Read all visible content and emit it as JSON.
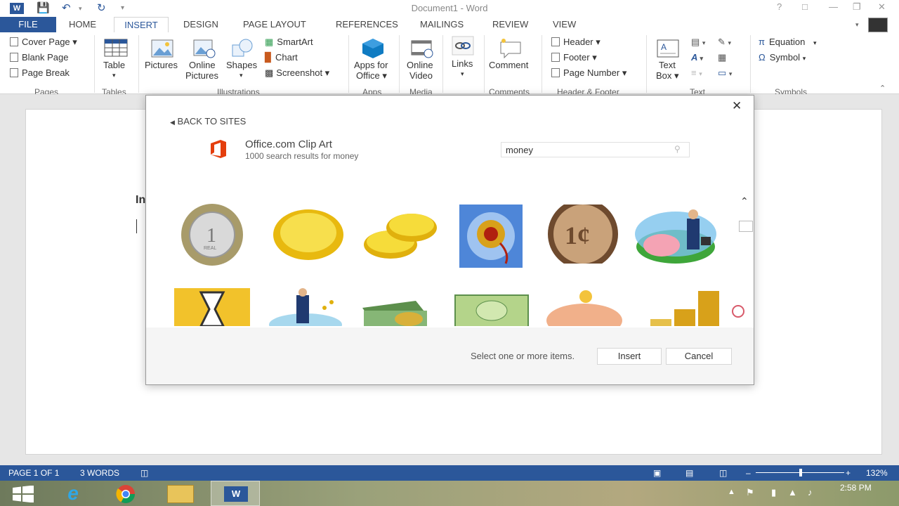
{
  "titlebar": {
    "title": "Document1 - Word",
    "help": "?"
  },
  "tabs": [
    "FILE",
    "HOME",
    "INSERT",
    "DESIGN",
    "PAGE LAYOUT",
    "REFERENCES",
    "MAILINGS",
    "REVIEW",
    "VIEW"
  ],
  "ribbon": {
    "pages": {
      "cover": "Cover Page",
      "blank": "Blank Page",
      "break": "Page Break",
      "group": "Pages"
    },
    "tables": {
      "table": "Table",
      "group": "Tables"
    },
    "illustrations": {
      "pictures": "Pictures",
      "online1": "Online",
      "online2": "Pictures",
      "shapes": "Shapes",
      "smartart": "SmartArt",
      "chart": "Chart",
      "screenshot": "Screenshot",
      "group": "Illustrations"
    },
    "apps": {
      "l1": "Apps for",
      "l2": "Office",
      "group": "Apps"
    },
    "media": {
      "l1": "Online",
      "l2": "Video",
      "group": "Media"
    },
    "links": {
      "label": "Links"
    },
    "comments": {
      "comment": "Comment",
      "group": "Comments"
    },
    "hf": {
      "header": "Header",
      "footer": "Footer",
      "pagenum": "Page Number",
      "group": "Header & Footer"
    },
    "text": {
      "l1": "Text",
      "l2": "Box",
      "group": "Text"
    },
    "symbols": {
      "equation": "Equation",
      "symbol": "Symbol",
      "group": "Symbols"
    }
  },
  "dialog": {
    "back": "BACK TO SITES",
    "source": "Office.com Clip Art",
    "results": "1000 search results for money",
    "search_value": "money",
    "hint": "Select one or more items.",
    "insert": "Insert",
    "cancel": "Cancel",
    "coin1_text": "1",
    "coin1_sub": "REAL",
    "cent_text": "1¢"
  },
  "doc": {
    "partial_text": "In"
  },
  "status": {
    "page": "PAGE 1 OF 1",
    "words": "3 WORDS",
    "zoom": "132%"
  },
  "taskbar": {
    "time": "2:58 PM"
  },
  "colors": {
    "word_blue": "#2b579a",
    "office_red": "#e43e0d",
    "apps_blue": "#0f7bc2"
  }
}
